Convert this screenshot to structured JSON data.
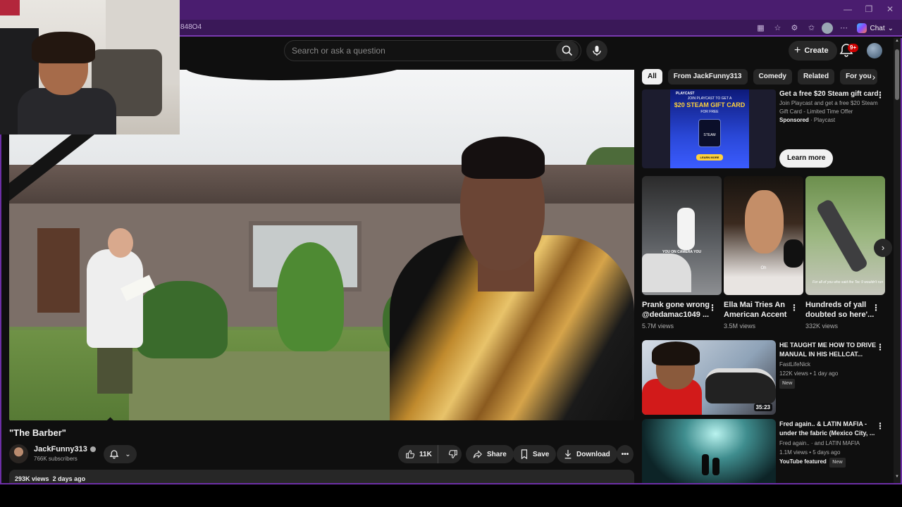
{
  "browser": {
    "url_fragment": "848O4",
    "chat_label": "Chat"
  },
  "masthead": {
    "search_placeholder": "Search or ask a question",
    "create_label": "Create",
    "notification_count": "9+"
  },
  "video": {
    "title": "\"The Barber\"",
    "channel": "JackFunny313",
    "subscribers": "766K subscribers",
    "likes": "11K",
    "share_label": "Share",
    "save_label": "Save",
    "download_label": "Download",
    "views": "293K views",
    "uploaded": "2 days ago"
  },
  "chips": [
    "All",
    "From JackFunny313",
    "Comedy",
    "Related",
    "For you"
  ],
  "ad": {
    "brand_logo": "PLAYCAST",
    "thumb_line1": "JOIN PLAYCAST TO GET A",
    "thumb_line2": "$20 STEAM GIFT CARD",
    "thumb_line3": "FOR FREE",
    "thumb_steam": "STEAM",
    "thumb_cta": "LEARN MORE",
    "title": "Get a free $20 Steam gift card",
    "description": "Join Playcast and get a free $20 Steam Gift Card - Limited Time Offer",
    "sponsored": "Sponsored",
    "advertiser": "Playcast",
    "cta": "Learn more"
  },
  "shorts": [
    {
      "title": "Prank gone wrong @dedamac1049 ...",
      "views": "5.7M views",
      "caption": "YOU ON CAMERA YOU"
    },
    {
      "title": "Ella Mai Tries An American Accent",
      "views": "3.5M views",
      "caption": "Oh"
    },
    {
      "title": "Hundreds of yall doubted so here'...",
      "views": "332K views",
      "caption": "For all of you who said the Tec 9 wouldn't run"
    }
  ],
  "videos": [
    {
      "title": "HE TAUGHT ME HOW TO DRIVE MANUAL IN HIS HELLCAT...",
      "channel": "FastLifeNick",
      "meta": "122K views • 1 day ago",
      "badge": "New",
      "duration": "35:23"
    },
    {
      "title": "Fred again.. & LATIN MAFIA - under the fabric (Mexico City, ...",
      "channel": "Fred again.. · and LATIN MAFIA",
      "meta": "1.1M views • 5 days ago",
      "featured": "YouTube featured",
      "badge": "New"
    }
  ]
}
